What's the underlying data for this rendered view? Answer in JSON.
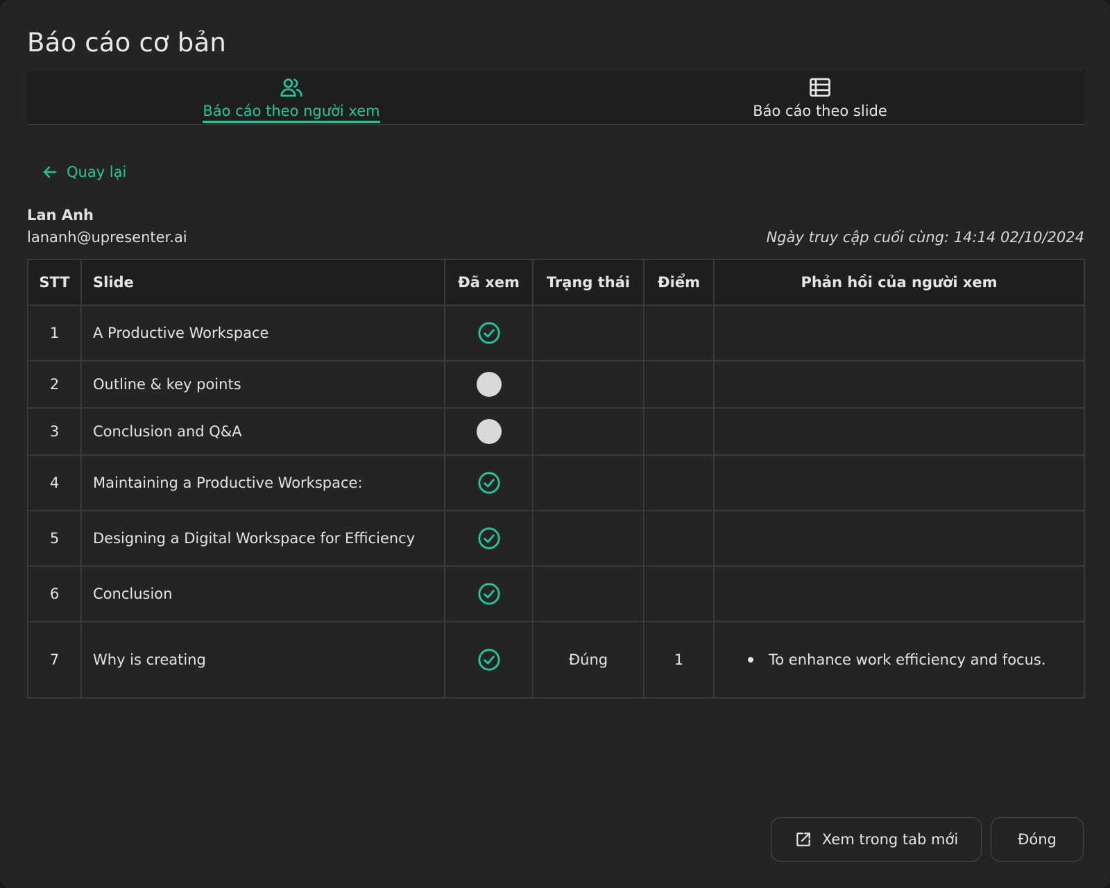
{
  "dialog": {
    "title": "Báo cáo cơ bản"
  },
  "tabs": [
    {
      "label": "Báo cáo theo người xem",
      "icon": "users-icon",
      "active": true
    },
    {
      "label": "Báo cáo theo slide",
      "icon": "table-list-icon",
      "active": false
    }
  ],
  "back": {
    "label": "Quay lại",
    "icon": "arrow-left-icon"
  },
  "viewer": {
    "name": "Lan Anh",
    "email": "lananh@upresenter.ai",
    "last_access": "Ngày truy cập cuối cùng: 14:14 02/10/2024"
  },
  "table": {
    "headers": {
      "stt": "STT",
      "slide": "Slide",
      "viewed": "Đã xem",
      "status": "Trạng thái",
      "score": "Điểm",
      "feedback": "Phản hồi của người xem"
    },
    "rows": [
      {
        "stt": "1",
        "slide": "A Productive Workspace",
        "viewed": true,
        "status": "",
        "score": "",
        "feedback": ""
      },
      {
        "stt": "2",
        "slide": "Outline & key points",
        "viewed": false,
        "status": "",
        "score": "",
        "feedback": ""
      },
      {
        "stt": "3",
        "slide": "Conclusion and Q&A",
        "viewed": false,
        "status": "",
        "score": "",
        "feedback": ""
      },
      {
        "stt": "4",
        "slide": "Maintaining a Productive Workspace:",
        "viewed": true,
        "status": "",
        "score": "",
        "feedback": ""
      },
      {
        "stt": "5",
        "slide": "Designing a Digital Workspace for Efficiency",
        "viewed": true,
        "status": "",
        "score": "",
        "feedback": ""
      },
      {
        "stt": "6",
        "slide": "Conclusion",
        "viewed": true,
        "status": "",
        "score": "",
        "feedback": ""
      },
      {
        "stt": "7",
        "slide": "Why is creating",
        "viewed": true,
        "status": "Đúng",
        "score": "1",
        "feedback": "To enhance work efficiency and focus."
      }
    ]
  },
  "footer": {
    "open_new_tab_label": "Xem trong tab mới",
    "open_new_tab_icon": "external-link-icon",
    "close_label": "Đóng"
  },
  "colors": {
    "accent": "#20c997",
    "background": "#242424",
    "unviewed_dot": "#d9d9d9"
  }
}
